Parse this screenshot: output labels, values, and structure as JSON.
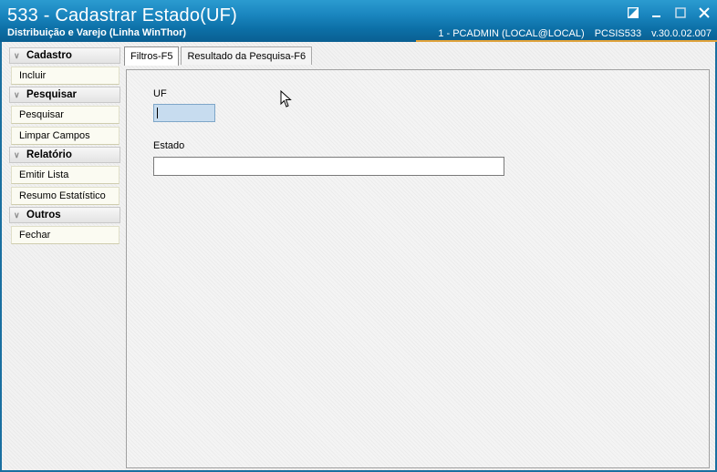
{
  "window": {
    "title": "533 - Cadastrar Estado(UF)",
    "subtitle": "Distribuição e Varejo (Linha WinThor)",
    "user": "1 - PCADMIN (LOCAL@LOCAL)",
    "program": "PCSIS533",
    "version": "v.30.0.02.007"
  },
  "sidebar": {
    "groups": [
      {
        "title": "Cadastro",
        "items": [
          {
            "label": "Incluir"
          }
        ]
      },
      {
        "title": "Pesquisar",
        "items": [
          {
            "label": "Pesquisar"
          },
          {
            "label": "Limpar Campos"
          }
        ]
      },
      {
        "title": "Relatório",
        "items": [
          {
            "label": "Emitir Lista"
          },
          {
            "label": "Resumo Estatístico"
          }
        ]
      },
      {
        "title": "Outros",
        "items": [
          {
            "label": "Fechar"
          }
        ]
      }
    ]
  },
  "tabs": [
    {
      "label": "Filtros-F5",
      "active": true
    },
    {
      "label": "Resultado da Pesquisa-F6",
      "active": false
    }
  ],
  "filters": {
    "uf_label": "UF",
    "uf_value": "",
    "estado_label": "Estado",
    "estado_value": ""
  },
  "colors": {
    "titlebar": "#1a86bf",
    "accent_line": "#e0a23a",
    "uf_field_focus": "#c7dcef"
  }
}
